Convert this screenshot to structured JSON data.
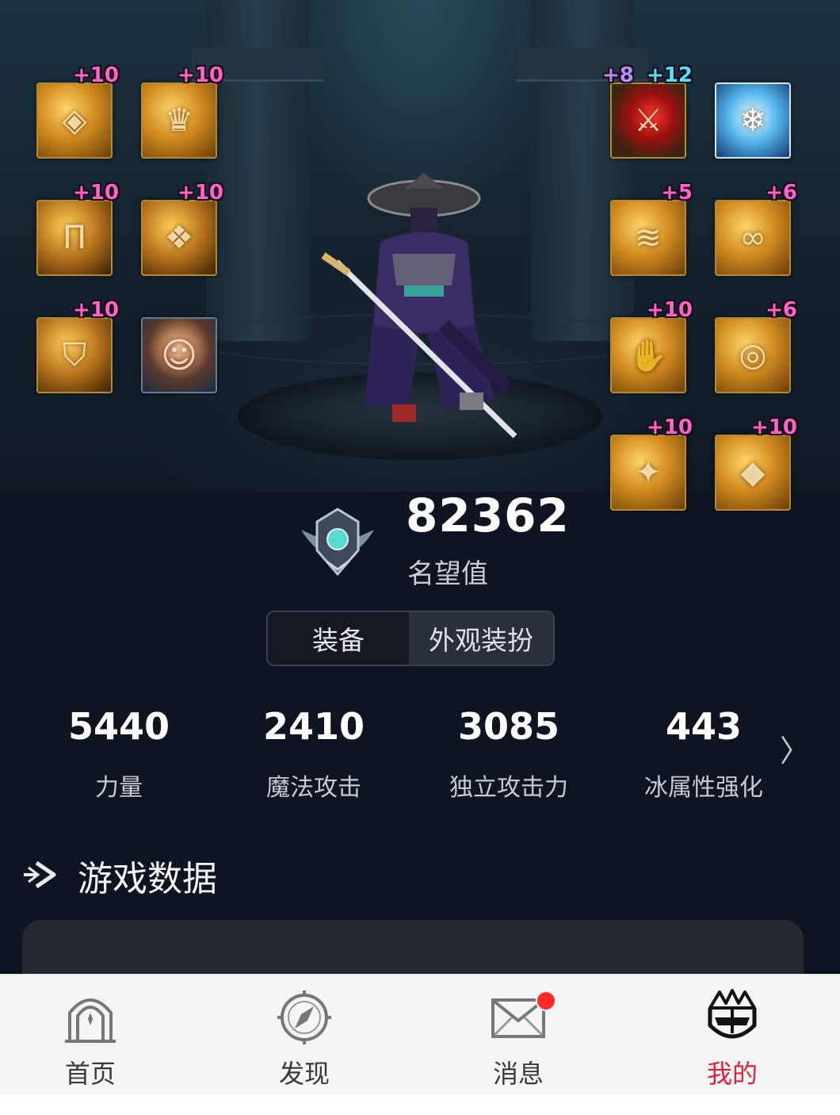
{
  "equipment": {
    "left_slots": [
      {
        "name": "shoulder",
        "badge": "+10"
      },
      {
        "name": "top",
        "badge": "+10"
      },
      {
        "name": "bottom",
        "badge": "+10"
      },
      {
        "name": "belt",
        "badge": "+10"
      },
      {
        "name": "shoes",
        "badge": "+10"
      },
      {
        "name": "title-portrait",
        "badge": ""
      }
    ],
    "right_slots": [
      {
        "name": "weapon",
        "badge_a": "+8",
        "badge_b": "+12"
      },
      {
        "name": "costume-emblem",
        "badge": ""
      },
      {
        "name": "bracelet",
        "badge": "+5"
      },
      {
        "name": "necklace",
        "badge": "+6"
      },
      {
        "name": "gloves",
        "badge": "+10"
      },
      {
        "name": "ring",
        "badge": "+6"
      },
      {
        "name": "support",
        "badge": "+10"
      },
      {
        "name": "magic-stone",
        "badge": "+10"
      }
    ]
  },
  "reputation": {
    "value": "82362",
    "label": "名望值"
  },
  "tabs": {
    "equipment": "装备",
    "appearance": "外观装扮"
  },
  "stats": [
    {
      "value": "5440",
      "label": "力量"
    },
    {
      "value": "2410",
      "label": "魔法攻击"
    },
    {
      "value": "3085",
      "label": "独立攻击力"
    },
    {
      "value": "443",
      "label": "冰属性强化"
    }
  ],
  "section": {
    "title": "游戏数据"
  },
  "nav": {
    "home": "首页",
    "discover": "发现",
    "messages": "消息",
    "mine": "我的"
  },
  "colors": {
    "background": "#0f1520",
    "badge_pink": "#ff62c8",
    "nav_active": "#e0203a",
    "notification": "#ff2a2a"
  }
}
